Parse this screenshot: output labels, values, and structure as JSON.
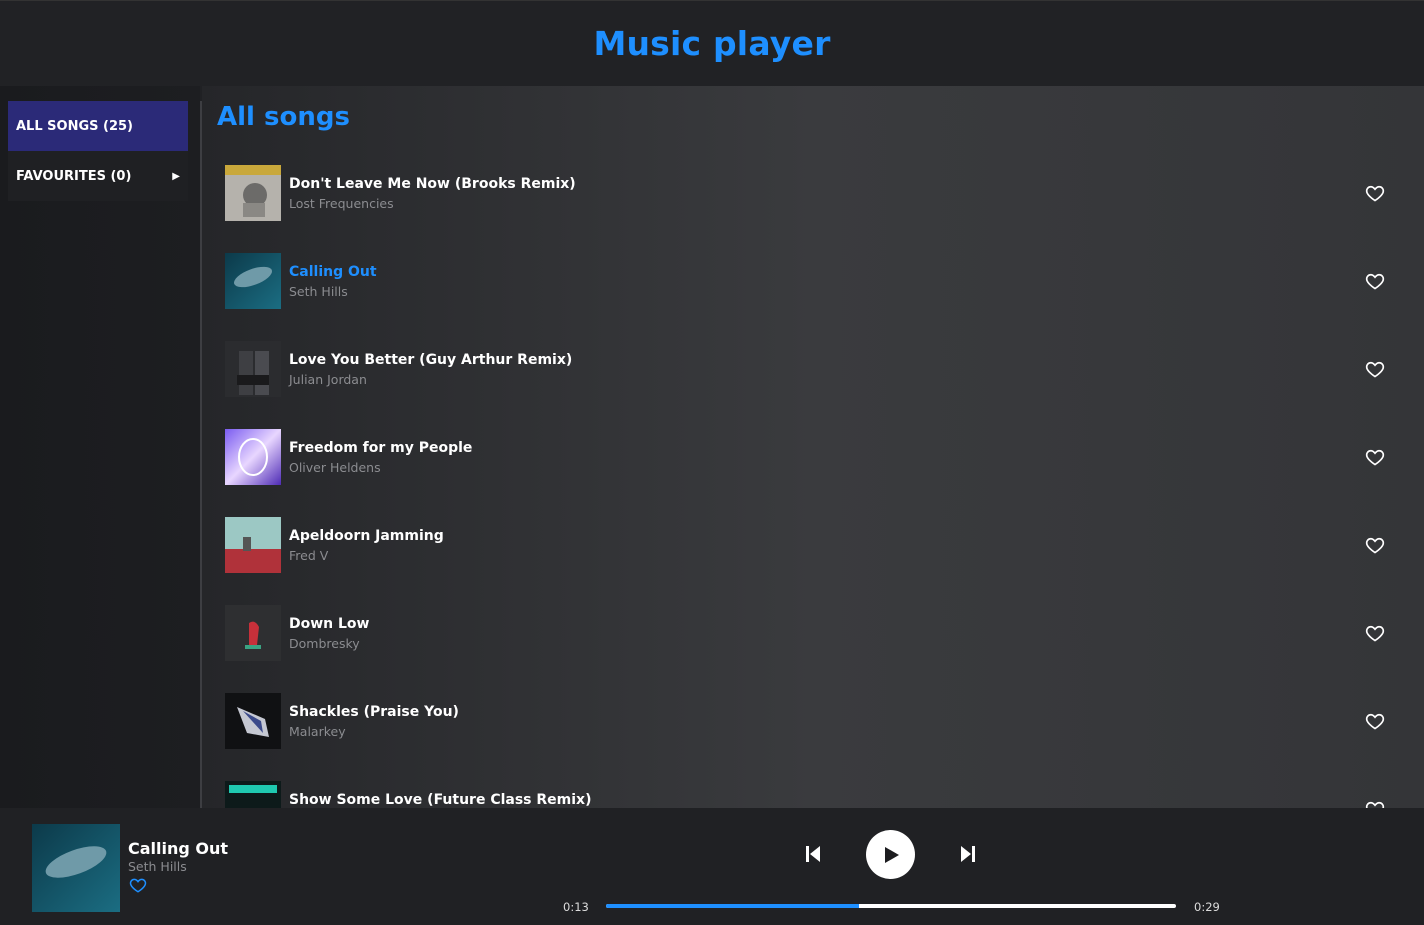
{
  "header": {
    "title": "Music player"
  },
  "sidebar": {
    "items": [
      {
        "label": "ALL SONGS (25)",
        "active": true
      },
      {
        "label": "FAVOURITES (0)",
        "active": false
      }
    ]
  },
  "main": {
    "title": "All songs"
  },
  "songs": [
    {
      "title": "Don't Leave Me Now (Brooks Remix)",
      "artist": "Lost Frequencies",
      "playing": false,
      "favourite": false
    },
    {
      "title": "Calling Out",
      "artist": "Seth Hills",
      "playing": true,
      "favourite": false
    },
    {
      "title": "Love You Better (Guy Arthur Remix)",
      "artist": "Julian Jordan",
      "playing": false,
      "favourite": false
    },
    {
      "title": "Freedom for my People",
      "artist": "Oliver Heldens",
      "playing": false,
      "favourite": false
    },
    {
      "title": "Apeldoorn Jamming",
      "artist": "Fred V",
      "playing": false,
      "favourite": false
    },
    {
      "title": "Down Low",
      "artist": "Dombresky",
      "playing": false,
      "favourite": false
    },
    {
      "title": "Shackles (Praise You)",
      "artist": "Malarkey",
      "playing": false,
      "favourite": false
    },
    {
      "title": "Show Some Love (Future Class Remix)",
      "artist": "",
      "playing": false,
      "favourite": false
    }
  ],
  "player": {
    "title": "Calling Out",
    "artist": "Seth Hills",
    "current_time": "0:13",
    "duration": "0:29",
    "progress": 0.444
  },
  "colors": {
    "accent": "#1e8fff",
    "sidebar_active": "#2b2a78"
  }
}
